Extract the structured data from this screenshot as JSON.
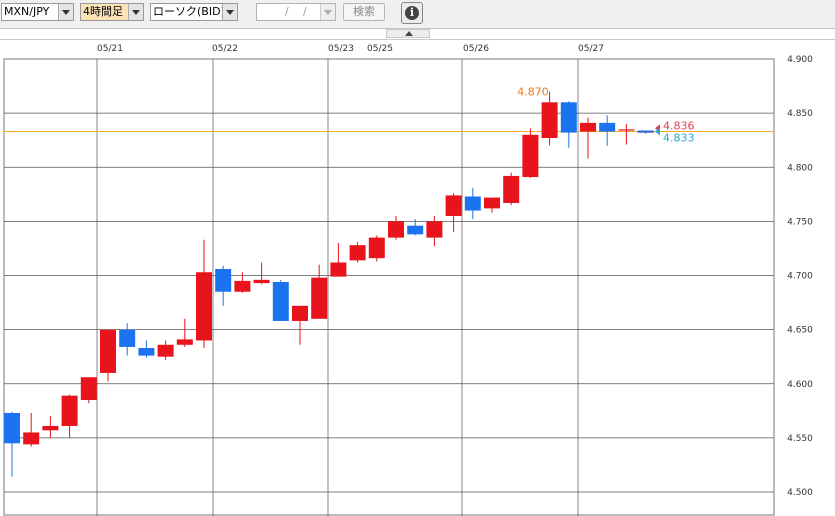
{
  "toolbar": {
    "pair": "MXN/JPY",
    "timeframe": "4時間足",
    "chart_kind": "ローソク(BID)",
    "date_sep_1": "/",
    "date_sep_2": "/",
    "search_label": "検索",
    "info_glyph": "i"
  },
  "chart_data": {
    "type": "candlestick",
    "x_tick_labels": [
      "05/21",
      "05/22",
      "05/23",
      "05/25",
      "05/26",
      "05/27"
    ],
    "y_ticks": [
      "4.900",
      "4.850",
      "4.800",
      "4.750",
      "4.700",
      "4.650",
      "4.600",
      "4.550",
      "4.500"
    ],
    "ylim": [
      4.5,
      4.9
    ],
    "grid": true,
    "colors": {
      "up": "#e8131b",
      "down": "#1c73f0",
      "current_line": "#f5a623",
      "high_label": "#f07a1e",
      "ask_label": "#e23c5a",
      "bid_label": "#2aa6d6"
    },
    "candles": [
      {
        "o": 4.573,
        "h": 4.574,
        "l": 4.514,
        "c": 4.545
      },
      {
        "o": 4.544,
        "h": 4.573,
        "l": 4.542,
        "c": 4.555
      },
      {
        "o": 4.557,
        "h": 4.57,
        "l": 4.55,
        "c": 4.561
      },
      {
        "o": 4.561,
        "h": 4.59,
        "l": 4.55,
        "c": 4.589
      },
      {
        "o": 4.585,
        "h": 4.602,
        "l": 4.582,
        "c": 4.606
      },
      {
        "o": 4.61,
        "h": 4.64,
        "l": 4.602,
        "c": 4.65
      },
      {
        "o": 4.65,
        "h": 4.656,
        "l": 4.626,
        "c": 4.634
      },
      {
        "o": 4.633,
        "h": 4.64,
        "l": 4.624,
        "c": 4.626
      },
      {
        "o": 4.625,
        "h": 4.64,
        "l": 4.622,
        "c": 4.636
      },
      {
        "o": 4.636,
        "h": 4.66,
        "l": 4.634,
        "c": 4.641
      },
      {
        "o": 4.64,
        "h": 4.733,
        "l": 4.633,
        "c": 4.703
      },
      {
        "o": 4.706,
        "h": 4.709,
        "l": 4.672,
        "c": 4.685
      },
      {
        "o": 4.685,
        "h": 4.703,
        "l": 4.684,
        "c": 4.695
      },
      {
        "o": 4.693,
        "h": 4.712,
        "l": 4.692,
        "c": 4.696
      },
      {
        "o": 4.694,
        "h": 4.696,
        "l": 4.658,
        "c": 4.658
      },
      {
        "o": 4.658,
        "h": 4.67,
        "l": 4.636,
        "c": 4.672
      },
      {
        "o": 4.66,
        "h": 4.71,
        "l": 4.66,
        "c": 4.698
      },
      {
        "o": 4.699,
        "h": 4.73,
        "l": 4.699,
        "c": 4.712
      },
      {
        "o": 4.714,
        "h": 4.731,
        "l": 4.712,
        "c": 4.728
      },
      {
        "o": 4.716,
        "h": 4.737,
        "l": 4.713,
        "c": 4.735
      },
      {
        "o": 4.735,
        "h": 4.755,
        "l": 4.733,
        "c": 4.75
      },
      {
        "o": 4.746,
        "h": 4.752,
        "l": 4.737,
        "c": 4.738
      },
      {
        "o": 4.735,
        "h": 4.755,
        "l": 4.727,
        "c": 4.75
      },
      {
        "o": 4.755,
        "h": 4.776,
        "l": 4.74,
        "c": 4.774
      },
      {
        "o": 4.773,
        "h": 4.781,
        "l": 4.752,
        "c": 4.76
      },
      {
        "o": 4.762,
        "h": 4.77,
        "l": 4.758,
        "c": 4.772
      },
      {
        "o": 4.767,
        "h": 4.795,
        "l": 4.765,
        "c": 4.792
      },
      {
        "o": 4.791,
        "h": 4.836,
        "l": 4.79,
        "c": 4.83
      },
      {
        "o": 4.827,
        "h": 4.87,
        "l": 4.82,
        "c": 4.86
      },
      {
        "o": 4.86,
        "h": 4.861,
        "l": 4.818,
        "c": 4.832
      },
      {
        "o": 4.833,
        "h": 4.846,
        "l": 4.808,
        "c": 4.841
      },
      {
        "o": 4.841,
        "h": 4.848,
        "l": 4.82,
        "c": 4.833
      },
      {
        "o": 4.834,
        "h": 4.84,
        "l": 4.821,
        "c": 4.835
      },
      {
        "o": 4.832,
        "h": 4.834,
        "l": 4.831,
        "c": 4.833
      }
    ],
    "annotations": {
      "high": {
        "label": "4.870",
        "value": 4.87
      },
      "ask": {
        "label": "4.836",
        "value": 4.836
      },
      "bid": {
        "label": "4.833",
        "value": 4.833
      }
    },
    "current_price": 4.833
  }
}
